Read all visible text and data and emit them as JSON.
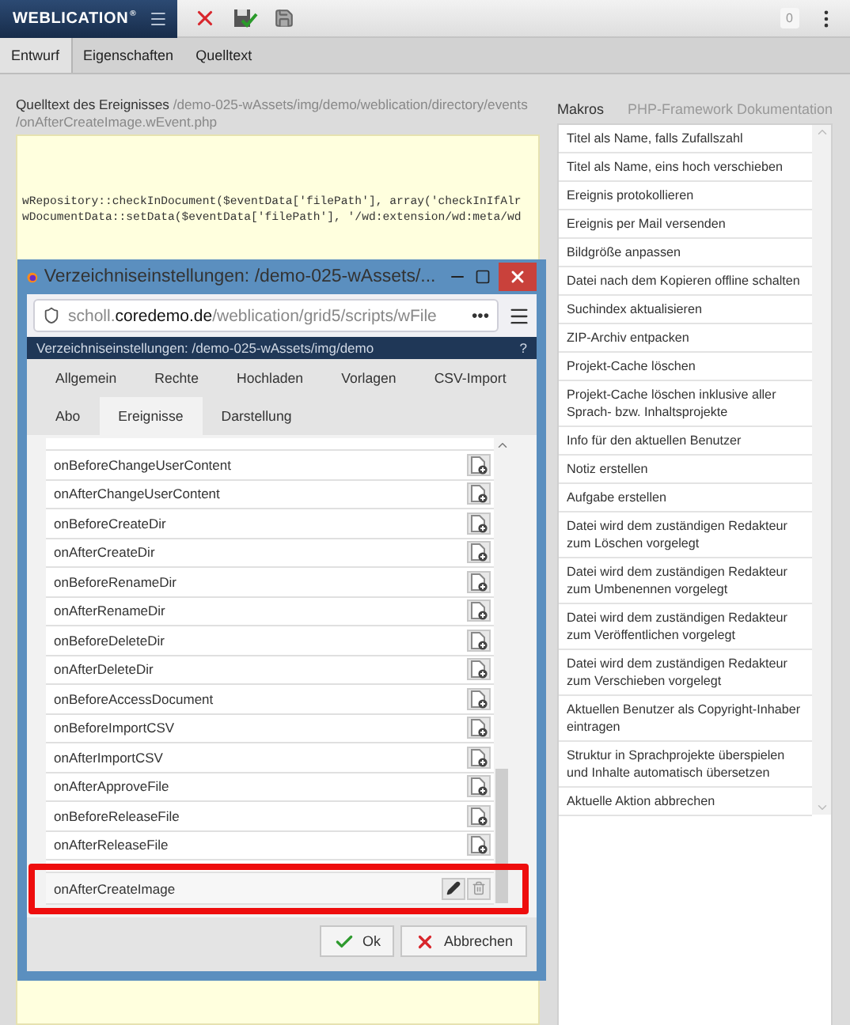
{
  "app_bar": {
    "logo": "WEBLICATION",
    "logo_mark": "®",
    "badge": "0"
  },
  "tabs": [
    {
      "label": "Entwurf",
      "selected": true
    },
    {
      "label": "Eigenschaften",
      "selected": false
    },
    {
      "label": "Quelltext",
      "selected": false
    }
  ],
  "source": {
    "label": "Quelltext des Ereignisses",
    "path": "/demo-025-wAssets/img/demo/weblication/directory/events /onAfterCreateImage.wEvent.php",
    "code_lines": [
      "wRepository::checkInDocument($eventData['filePath'], array('checkInIfAlr",
      "wDocumentData::setData($eventData['filePath'], '/wd:extension/wd:meta/wd"
    ]
  },
  "dialog": {
    "window_title": "Verzeichniseinstellungen: /demo-025-wAssets/...",
    "url": {
      "subdomain": "scholl.",
      "domain": "coredemo.de",
      "path": "/weblication/grid5/scripts/wFile",
      "more": "•••"
    },
    "header": "Verzeichniseinstellungen: /demo-025-wAssets/img/demo",
    "help": "?",
    "tab_rows": [
      [
        {
          "label": "Allgemein",
          "selected": false
        },
        {
          "label": "Rechte",
          "selected": false
        },
        {
          "label": "Hochladen",
          "selected": false
        },
        {
          "label": "Vorlagen",
          "selected": false
        },
        {
          "label": "CSV-Import",
          "selected": false
        }
      ],
      [
        {
          "label": "Abo",
          "selected": false
        },
        {
          "label": "Ereignisse",
          "selected": true
        },
        {
          "label": "Darstellung",
          "selected": false
        }
      ]
    ],
    "events": [
      {
        "kind": "cut",
        "highlighted": false
      },
      {
        "kind": "add",
        "label": "onBeforeChangeUserContent",
        "highlighted": false
      },
      {
        "kind": "add",
        "label": "onAfterChangeUserContent",
        "highlighted": false
      },
      {
        "kind": "add",
        "label": "onBeforeCreateDir",
        "highlighted": false
      },
      {
        "kind": "add",
        "label": "onAfterCreateDir",
        "highlighted": false
      },
      {
        "kind": "add",
        "label": "onBeforeRenameDir",
        "highlighted": false
      },
      {
        "kind": "add",
        "label": "onAfterRenameDir",
        "highlighted": false
      },
      {
        "kind": "add",
        "label": "onBeforeDeleteDir",
        "highlighted": false
      },
      {
        "kind": "add",
        "label": "onAfterDeleteDir",
        "highlighted": false
      },
      {
        "kind": "add",
        "label": "onBeforeAccessDocument",
        "highlighted": false
      },
      {
        "kind": "add",
        "label": "onBeforeImportCSV",
        "highlighted": false
      },
      {
        "kind": "add",
        "label": "onAfterImportCSV",
        "highlighted": false
      },
      {
        "kind": "add",
        "label": "onAfterApproveFile",
        "highlighted": false
      },
      {
        "kind": "add",
        "label": "onBeforeReleaseFile",
        "highlighted": false
      },
      {
        "kind": "add",
        "label": "onAfterReleaseFile",
        "highlighted": false
      },
      {
        "kind": "cut",
        "highlighted": false
      },
      {
        "kind": "assigned",
        "label": "onAfterCreateImage",
        "highlighted": true
      }
    ],
    "buttons": [
      {
        "kind": "ok",
        "label": "Ok"
      },
      {
        "kind": "cancel",
        "label": "Abbrechen"
      }
    ]
  },
  "macros": {
    "tabs": [
      {
        "label": "Makros",
        "selected": true
      },
      {
        "label": "PHP-Framework Dokumentation",
        "selected": false
      }
    ],
    "items": [
      "Titel als Name, falls Zufallszahl",
      "Titel als Name, eins hoch verschieben",
      "Ereignis protokollieren",
      "Ereignis per Mail versenden",
      "Bildgröße anpassen",
      "Datei nach dem Kopieren offline schalten",
      "Suchindex aktualisieren",
      "ZIP-Archiv entpacken",
      "Projekt-Cache löschen",
      "Projekt-Cache löschen inklusive aller Sprach- bzw. Inhaltsprojekte",
      "Info für den aktuellen Benutzer",
      "Notiz erstellen",
      "Aufgabe erstellen",
      "Datei wird dem zuständigen Redakteur zum Löschen vorgelegt",
      "Datei wird dem zuständigen Redakteur zum Umbenennen vorgelegt",
      "Datei wird dem zuständigen Redakteur zum Veröffentlichen vorgelegt",
      "Datei wird dem zuständigen Redakteur zum Verschieben vorgelegt",
      "Aktuellen Benutzer als Copyright-Inhaber eintragen",
      "Struktur in Sprachprojekte überspielen und Inhalte automatisch übersetzen",
      "Aktuelle Aktion abbrechen"
    ]
  }
}
